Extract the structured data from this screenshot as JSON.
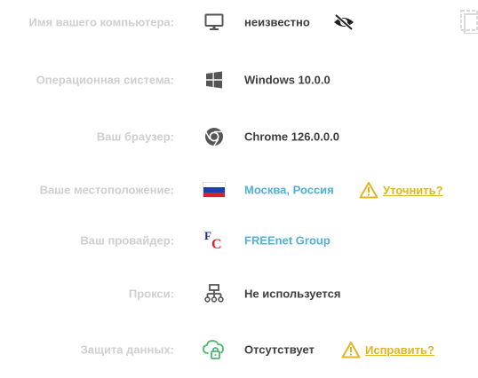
{
  "rows": [
    {
      "label": "Имя вашего компьютера:",
      "icon": "monitor-icon",
      "value": "неизвестно",
      "extra_icon": "eye-hidden-icon"
    },
    {
      "label": "Операционная система:",
      "icon": "windows-icon",
      "value": "Windows 10.0.0"
    },
    {
      "label": "Ваш браузер:",
      "icon": "chrome-icon",
      "value": "Chrome 126.0.0.0"
    },
    {
      "label": "Ваше местоположение:",
      "icon": "russia-flag-icon",
      "value": "Москва, Россия",
      "action_icon": "warning-icon",
      "action": "Уточнить?"
    },
    {
      "label": "Ваш провайдер:",
      "icon": "freenet-logo",
      "value": "FREEnet Group",
      "logo_f": "F",
      "logo_c": "C"
    },
    {
      "label": "Прокси:",
      "icon": "network-icon",
      "value": "Не используется"
    },
    {
      "label": "Защита данных:",
      "icon": "cloud-lock-icon",
      "value": "Отсутствует",
      "action_icon": "warning-icon",
      "action": "Исправить?"
    }
  ],
  "edge_icon": "copy-icon",
  "colors": {
    "label": "#cfcfcf",
    "value": "#3d3d3d",
    "link": "#4fb0d8",
    "warning": "#e0b520",
    "secure": "#4cb86a",
    "logo_blue": "#1b2a8a",
    "logo_red": "#e0242a"
  }
}
